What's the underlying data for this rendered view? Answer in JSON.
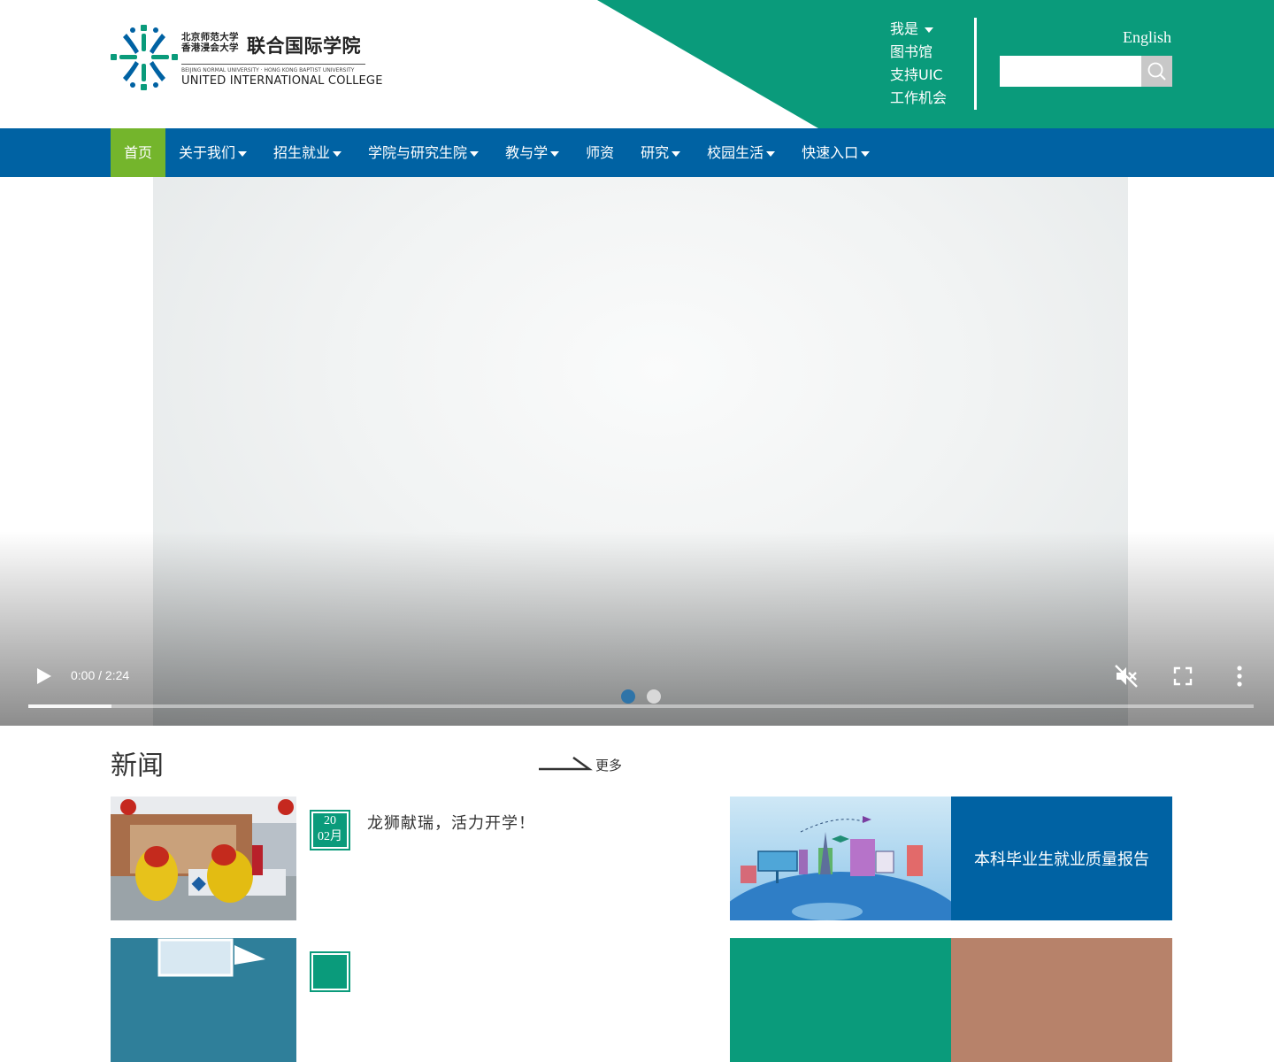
{
  "colors": {
    "teal": "#0a9b7b",
    "nav_blue": "#0062a3",
    "active_green": "#74b52c"
  },
  "logo": {
    "cn_line1": "北京师范大学",
    "cn_line2": "香港浸会大学",
    "cn_big": "联合国际学院",
    "en_small": "BEIJING NORMAL UNIVERSITY · HONG KONG BAPTIST UNIVERSITY",
    "en_big": "UNITED INTERNATIONAL COLLEGE"
  },
  "header": {
    "links": [
      {
        "label": "我是",
        "dropdown": true
      },
      {
        "label": "图书馆"
      },
      {
        "label": "支持UIC"
      },
      {
        "label": "工作机会"
      }
    ],
    "language": "English",
    "search": {
      "placeholder": "",
      "value": "",
      "icon": "search-icon"
    }
  },
  "nav": {
    "items": [
      {
        "label": "首页",
        "active": true,
        "dropdown": false
      },
      {
        "label": "关于我们",
        "dropdown": true
      },
      {
        "label": "招生就业",
        "dropdown": true
      },
      {
        "label": "学院与研究生院",
        "dropdown": true
      },
      {
        "label": "教与学",
        "dropdown": true
      },
      {
        "label": "师资",
        "dropdown": false
      },
      {
        "label": "研究",
        "dropdown": true
      },
      {
        "label": "校园生活",
        "dropdown": true
      },
      {
        "label": "快速入口",
        "dropdown": true
      }
    ]
  },
  "video": {
    "time": "0:00 / 2:24",
    "progress_fraction": 0.068,
    "controls": [
      "play-icon",
      "mute-icon",
      "fullscreen-icon",
      "more-vertical-icon"
    ],
    "slides": 2,
    "active_slide": 1
  },
  "news": {
    "title": "新闻",
    "more": "更多",
    "items": [
      {
        "day": "20",
        "month": "02月",
        "headline": "龙狮献瑞，活力开学！"
      },
      {
        "day": "",
        "month": "",
        "headline": ""
      }
    ]
  },
  "promos": [
    {
      "label": "本科毕业生就业质量报告"
    },
    {
      "label": ""
    }
  ]
}
